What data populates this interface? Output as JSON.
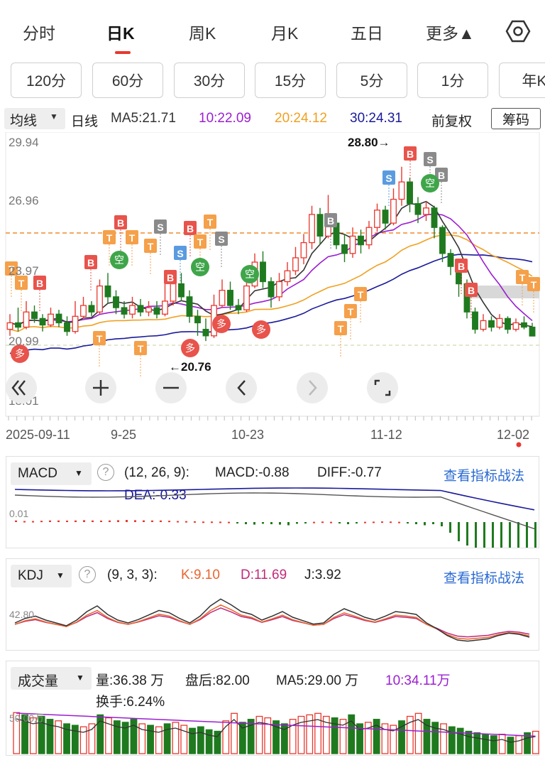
{
  "tabs": [
    {
      "label": "分时"
    },
    {
      "label": "日K"
    },
    {
      "label": "周K"
    },
    {
      "label": "月K"
    },
    {
      "label": "五日"
    },
    {
      "label": "更多▲"
    }
  ],
  "periods": [
    "120分",
    "60分",
    "30分",
    "15分",
    "5分",
    "1分",
    "年K"
  ],
  "ma": {
    "selector": "均线",
    "kind": "日线",
    "ma5": "MA5:21.71",
    "ma10": "10:22.09",
    "ma20": "20:24.12",
    "ma30": "30:24.31",
    "adjust": "前复权",
    "chips_button": "筹码"
  },
  "main_chart": {
    "y_labels": [
      "29.94",
      "26.96",
      "23.97",
      "20.99",
      "18.01"
    ],
    "high_marker": "28.80→",
    "low_marker": "←20.76",
    "x_labels": [
      "2025-09-11",
      "9-25",
      "10-23",
      "11-12",
      "12-02"
    ]
  },
  "signals": {
    "buy": "B",
    "sell": "S",
    "take": "T",
    "long": "多",
    "short": "空"
  },
  "macd": {
    "selector": "MACD",
    "params": "(12, 26, 9):",
    "macd": "MACD:-0.88",
    "diff": "DIFF:-0.77",
    "dea": "DEA:-0.33",
    "axis": "0.01",
    "link": "查看指标战法"
  },
  "kdj": {
    "selector": "KDJ",
    "params": "(9, 3, 3):",
    "k": "K:9.10",
    "d": "D:11.69",
    "j": "J:3.92",
    "axis": "42.80",
    "link": "查看指标战法"
  },
  "volume": {
    "selector": "成交量",
    "vol": "量:36.38 万",
    "after": "盘后:82.00",
    "ma5": "MA5:29.00 万",
    "ma10": "10:34.11万",
    "turnover": "换手:6.24%",
    "axis": "50.00万"
  },
  "colors": {
    "up": "#e8382f",
    "down": "#1f7a1f",
    "ma5": "#333333",
    "ma10": "#9b1fd1",
    "ma20": "#f0a020",
    "ma30": "#1a1a9a",
    "accent": "#e8382f"
  }
}
